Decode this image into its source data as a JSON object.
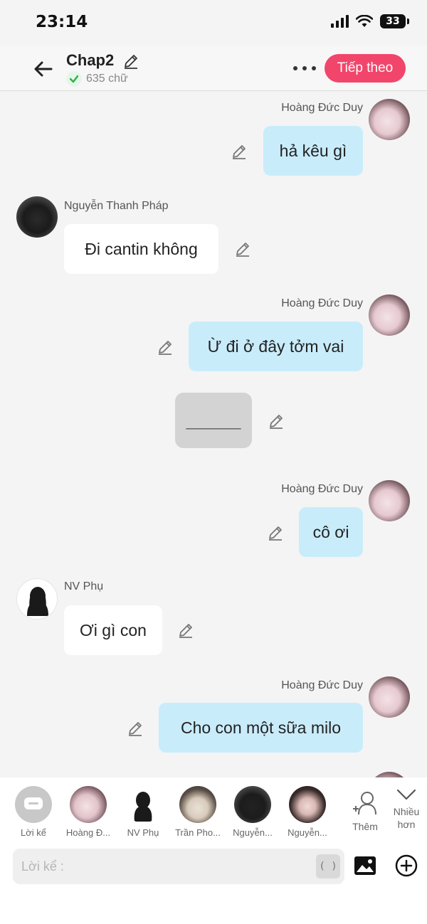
{
  "status_bar": {
    "time": "23:14",
    "battery": "33"
  },
  "header": {
    "title": "Chap2",
    "word_count": "635 chữ",
    "next_button": "Tiếp theo"
  },
  "messages": [
    {
      "side": "right",
      "speaker": "Hoàng Đức Duy",
      "text": "hả kêu gì"
    },
    {
      "side": "left",
      "speaker": "Nguyễn Thanh Pháp",
      "text": "Đi cantin không"
    },
    {
      "side": "right",
      "speaker": "Hoàng Đức Duy",
      "text": "Ừ đi ở đây tởm vai"
    },
    {
      "side": "narration",
      "text": "______"
    },
    {
      "side": "right",
      "speaker": "Hoàng Đức Duy",
      "text": "cô ơi"
    },
    {
      "side": "left",
      "speaker": "NV Phụ",
      "text": "Ơi gì con"
    },
    {
      "side": "right",
      "speaker": "Hoàng Đức Duy",
      "text": "Cho con một sữa milo"
    }
  ],
  "characters": [
    {
      "label": "Lời kể",
      "icon": "chat-bubble-icon"
    },
    {
      "label": "Hoàng Đ..."
    },
    {
      "label": "NV Phụ"
    },
    {
      "label": "Trần Pho..."
    },
    {
      "label": "Nguyễn..."
    },
    {
      "label": "Nguyễn..."
    }
  ],
  "add_character": {
    "label": "Thêm"
  },
  "more_characters": {
    "label_line1": "Nhiều",
    "label_line2": "hơn"
  },
  "input": {
    "placeholder": "Lời kể :",
    "paren_label": "( )"
  },
  "colors": {
    "accent": "#f2456b",
    "my_bubble": "#c9ecfb",
    "other_bubble": "#ffffff",
    "narration_bubble": "#d3d3d3"
  }
}
